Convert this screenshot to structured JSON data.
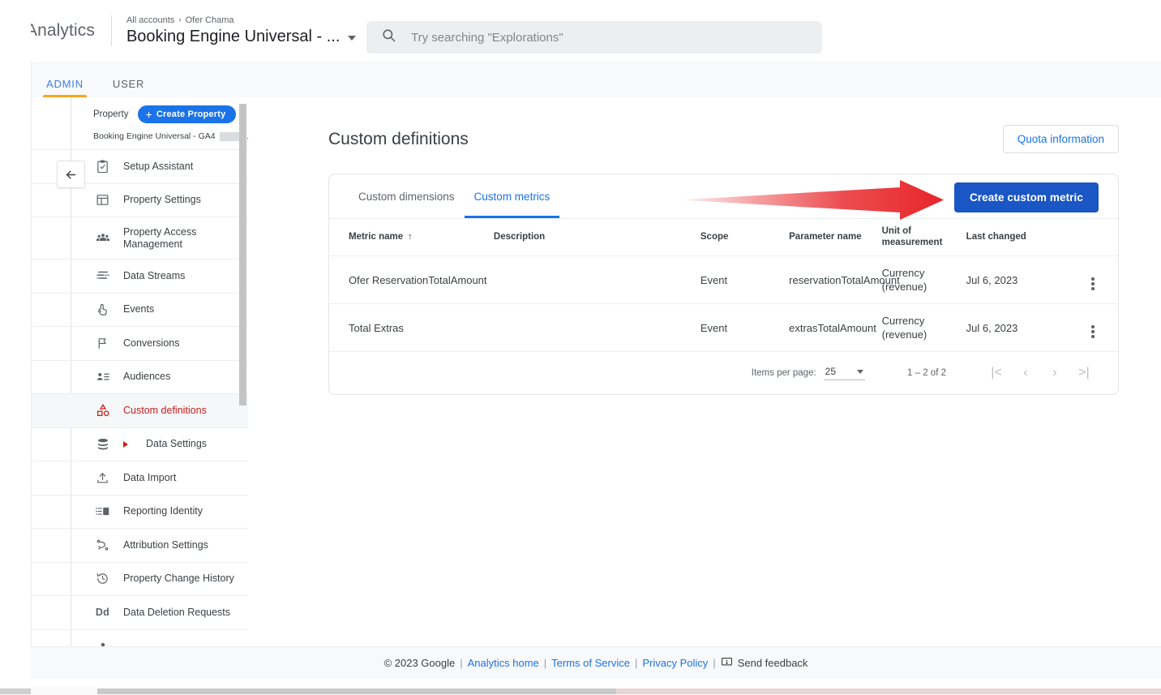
{
  "topbar": {
    "brand": "Analytics",
    "breadcrumb_root": "All accounts",
    "breadcrumb_sep": "›",
    "breadcrumb_account": "Ofer Chama",
    "property_title": "Booking Engine Universal - ...",
    "search_placeholder": "Try searching \"Explorations\"",
    "search_icon": "search-icon",
    "caret_icon": "chevron-down-icon"
  },
  "admin_tabs": [
    {
      "label": "ADMIN",
      "selected": true
    },
    {
      "label": "USER",
      "selected": false
    }
  ],
  "sidebar": {
    "property_label": "Property",
    "create_property_button": "Create Property",
    "plus_icon": "plus-icon",
    "property_name": "Booking Engine Universal - GA4",
    "property_name_suffix": ".",
    "collapse_icon": "arrow-left-icon",
    "items": [
      {
        "label": "Setup Assistant",
        "icon": "checklist-icon",
        "active": false
      },
      {
        "label": "Property Settings",
        "icon": "layout-icon",
        "active": false
      },
      {
        "label": "Property Access Management",
        "icon": "people-icon",
        "active": false,
        "two_line": true
      },
      {
        "label": "Data Streams",
        "icon": "data-streams-icon",
        "active": false
      },
      {
        "label": "Events",
        "icon": "tap-icon",
        "active": false
      },
      {
        "label": "Conversions",
        "icon": "flag-icon",
        "active": false
      },
      {
        "label": "Audiences",
        "icon": "person-list-icon",
        "active": false
      },
      {
        "label": "Custom definitions",
        "icon": "shapes-icon",
        "active": true
      },
      {
        "label": "Data Settings",
        "icon": "database-icon",
        "active": false,
        "expandable": true
      },
      {
        "label": "Data Import",
        "icon": "upload-icon",
        "active": false
      },
      {
        "label": "Reporting Identity",
        "icon": "reporting-identity-icon",
        "active": false
      },
      {
        "label": "Attribution Settings",
        "icon": "attribution-icon",
        "active": false
      },
      {
        "label": "Property Change History",
        "icon": "history-icon",
        "active": false
      },
      {
        "label": "Data Deletion Requests",
        "icon": "dd-text-icon",
        "active": false,
        "text_icon": "Dd"
      }
    ]
  },
  "main": {
    "page_title": "Custom definitions",
    "quota_button": "Quota information",
    "create_metric_button": "Create custom metric",
    "tabs": [
      {
        "label": "Custom dimensions",
        "selected": false
      },
      {
        "label": "Custom metrics",
        "selected": true
      }
    ],
    "table": {
      "columns": [
        "Metric name",
        "Description",
        "Scope",
        "Parameter name",
        "Unit of measurement",
        "Last changed"
      ],
      "sort_column": "Metric name",
      "sort_icon": "↑",
      "rows": [
        {
          "metric_name": "Ofer ReservationTotalAmount",
          "description": "",
          "scope": "Event",
          "parameter_name": "reservationTotalAmount",
          "unit": "Currency (revenue)",
          "last_changed": "Jul 6, 2023",
          "kebab_icon": "more-vert-icon"
        },
        {
          "metric_name": "Total Extras",
          "description": "",
          "scope": "Event",
          "parameter_name": "extrasTotalAmount",
          "unit": "Currency (revenue)",
          "last_changed": "Jul 6, 2023",
          "kebab_icon": "more-vert-icon"
        }
      ]
    },
    "pagination": {
      "items_per_page_label": "Items per page:",
      "items_per_page_value": "25",
      "range": "1 – 2 of 2",
      "first_page_icon": "|<",
      "prev_page_icon": "‹",
      "next_page_icon": "›",
      "last_page_icon": ">|"
    }
  },
  "footer": {
    "copyright": "© 2023 Google",
    "links": [
      "Analytics home",
      "Terms of Service",
      "Privacy Policy"
    ],
    "feedback": "Send feedback",
    "feedback_icon": "feedback-icon",
    "separator": "|"
  },
  "annotation": {
    "arrow_color": "#e8252a",
    "arrow_target": "create-custom-metric-button"
  },
  "colors": {
    "accent_blue": "#1a73e8",
    "button_blue": "#1a56c4",
    "admin_underline": "#f5a623",
    "active_red": "#c5221f",
    "text_primary": "#3c4043",
    "text_secondary": "#5f6368"
  }
}
